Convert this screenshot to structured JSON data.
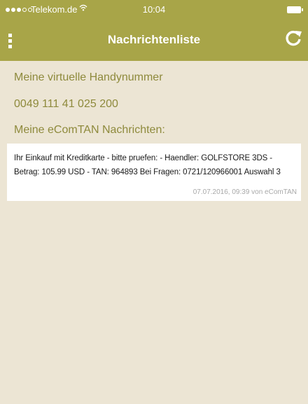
{
  "status_bar": {
    "carrier": "Telekom.de",
    "time": "10:04"
  },
  "nav": {
    "title": "Nachrichtenliste",
    "menu_icon": "kebab-menu-icon",
    "refresh_icon": "refresh-icon"
  },
  "content": {
    "phone_heading": "Meine virtuelle Handynummer",
    "phone_number": "0049 111 41 025 200",
    "messages_heading": "Meine eComTAN Nachrichten:"
  },
  "messages": [
    {
      "text": "Ihr Einkauf mit Kreditkarte - bitte pruefen: - Haendler: GOLFSTORE 3DS - Betrag: 105.99 USD - TAN: 964893 Bei Fragen: 0721/120966001 Auswahl 3",
      "meta": "07.07.2016, 09:39 von eComTAN"
    }
  ],
  "colors": {
    "header": "#a8a548",
    "background": "#ece5d4",
    "accent_text": "#8e8a3c"
  }
}
